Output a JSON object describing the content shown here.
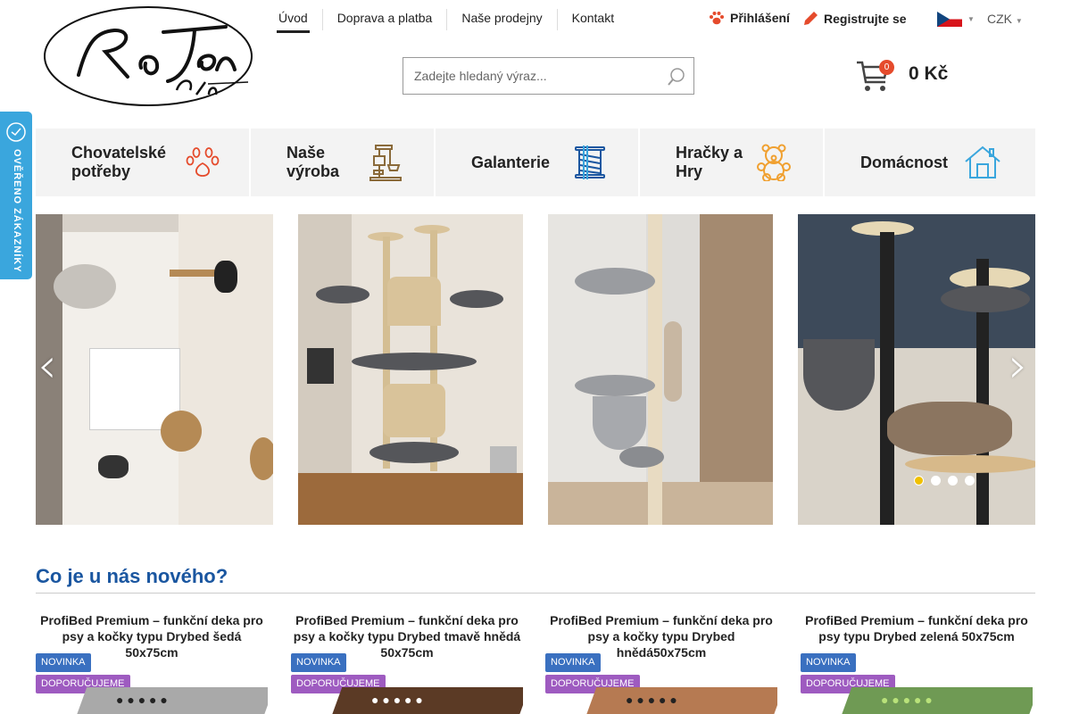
{
  "brand": {
    "logo_name": "RaJen Pets s.r.o."
  },
  "topnav": [
    "Úvod",
    "Doprava a platba",
    "Naše prodejny",
    "Kontakt"
  ],
  "user": {
    "login": "Přihlášení",
    "register": "Registrujte se"
  },
  "locale": {
    "flag": "czech-flag",
    "currency": "CZK"
  },
  "search": {
    "placeholder": "Zadejte hledaný výraz..."
  },
  "cart": {
    "count": "0",
    "total": "0 Kč"
  },
  "categories": [
    {
      "label": "Chovatelské potřeby",
      "icon": "paw-icon"
    },
    {
      "label": "Naše výroba",
      "icon": "cat-tree-icon"
    },
    {
      "label": "Galanterie",
      "icon": "thread-spool-icon"
    },
    {
      "label": "Hračky a Hry",
      "icon": "teddy-bear-icon"
    },
    {
      "label": "Domácnost",
      "icon": "house-icon"
    }
  ],
  "verified_badge": "OVĚŘENO ZÁKAZNÍKY",
  "slider": {
    "active_slide": 1,
    "slide_count": 4
  },
  "new_section": {
    "heading": "Co je u nás nového?",
    "products": [
      {
        "title": "ProfiBed Premium – funkční deka pro psy a kočky typu Drybed šedá 50x75cm",
        "tags": [
          "NOVINKA",
          "DOPORUČUJEME"
        ],
        "color": "#a9a9a9"
      },
      {
        "title": "ProfiBed Premium – funkční deka pro psy a kočky typu Drybed tmavě hnědá 50x75cm",
        "tags": [
          "NOVINKA",
          "DOPORUČUJEME"
        ],
        "color": "#5b3a25"
      },
      {
        "title": "ProfiBed Premium – funkční deka pro psy a kočky typu Drybed hnědá50x75cm",
        "tags": [
          "NOVINKA",
          "DOPORUČUJEME"
        ],
        "color": "#b67a52"
      },
      {
        "title": "ProfiBed Premium – funkční deka pro psy typu Drybed zelená 50x75cm",
        "tags": [
          "NOVINKA",
          "DOPORUČUJEME"
        ],
        "color": "#6f9a54"
      }
    ]
  },
  "colors": {
    "accent_red": "#e54b2c",
    "heading_blue": "#1a56a0",
    "badge_blue": "#3aa6dd",
    "tag_new": "#3a70c0",
    "tag_rec": "#9e5bc0",
    "active_dot": "#f0c000"
  }
}
